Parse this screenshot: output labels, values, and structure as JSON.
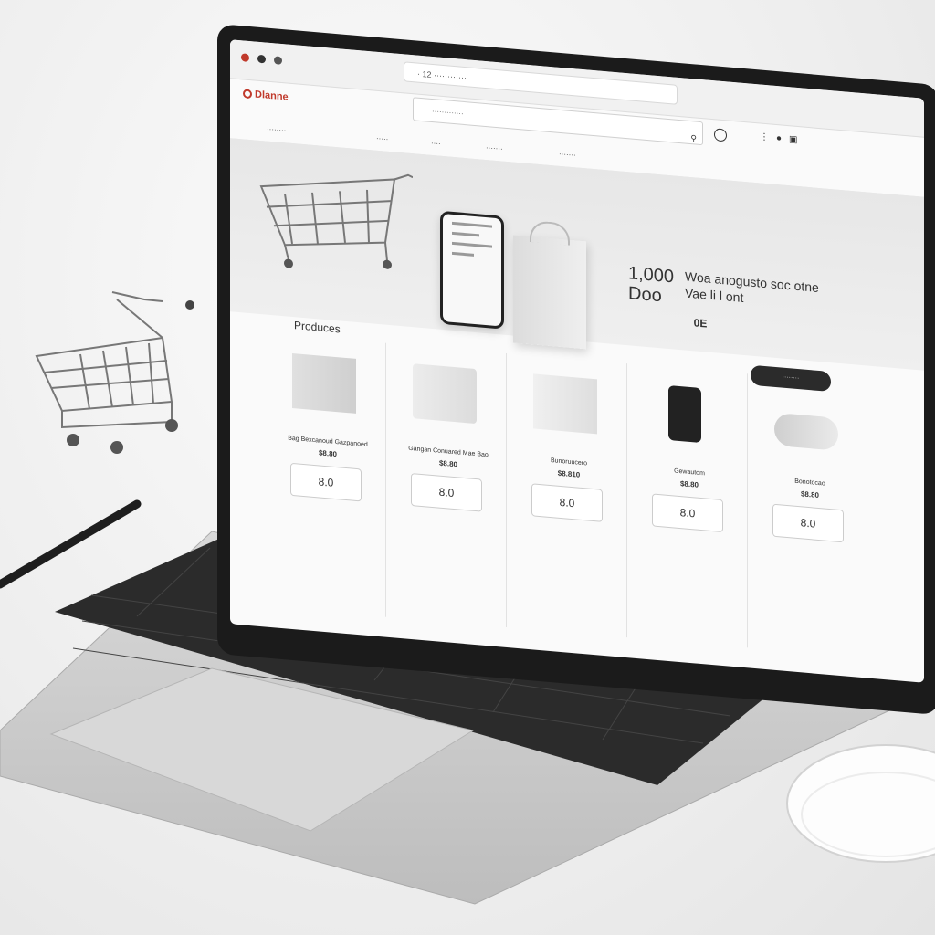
{
  "browser": {
    "url": "· 12  ············",
    "search_placeholder": "·············"
  },
  "brand": {
    "name": "Dlanne",
    "color": "#c0392b"
  },
  "nav": {
    "items": [
      "········",
      "·····",
      "····",
      "·······",
      "·······"
    ]
  },
  "hero": {
    "number_line1": "1,000",
    "number_line2": "Doo",
    "text_line1": "Woa anogusto soc otne",
    "text_line2": "Vae li l ont",
    "price_tag": "0E",
    "cta_label": "········"
  },
  "products_heading": "Produces",
  "products": [
    {
      "name": "Bag Bexcanoud Gazpanoed",
      "price": "$8.80",
      "button": "8.0"
    },
    {
      "name": "Gangan Conuared Mae Bao",
      "price": "$8.80",
      "button": "8.0"
    },
    {
      "name": "Bunoruucero",
      "price": "$8.810",
      "button": "8.0"
    },
    {
      "name": "Gewautom",
      "price": "$8.80",
      "button": "8.0"
    },
    {
      "name": "Bonotocao",
      "price": "$8.80",
      "button": "8.0"
    }
  ],
  "colors": {
    "accent": "#c0392b",
    "bezel": "#1b1b1b",
    "background": "#f0f0f0"
  },
  "icons": [
    "cart-icon",
    "user-icon",
    "search-icon",
    "bag-icon",
    "phone-icon"
  ]
}
